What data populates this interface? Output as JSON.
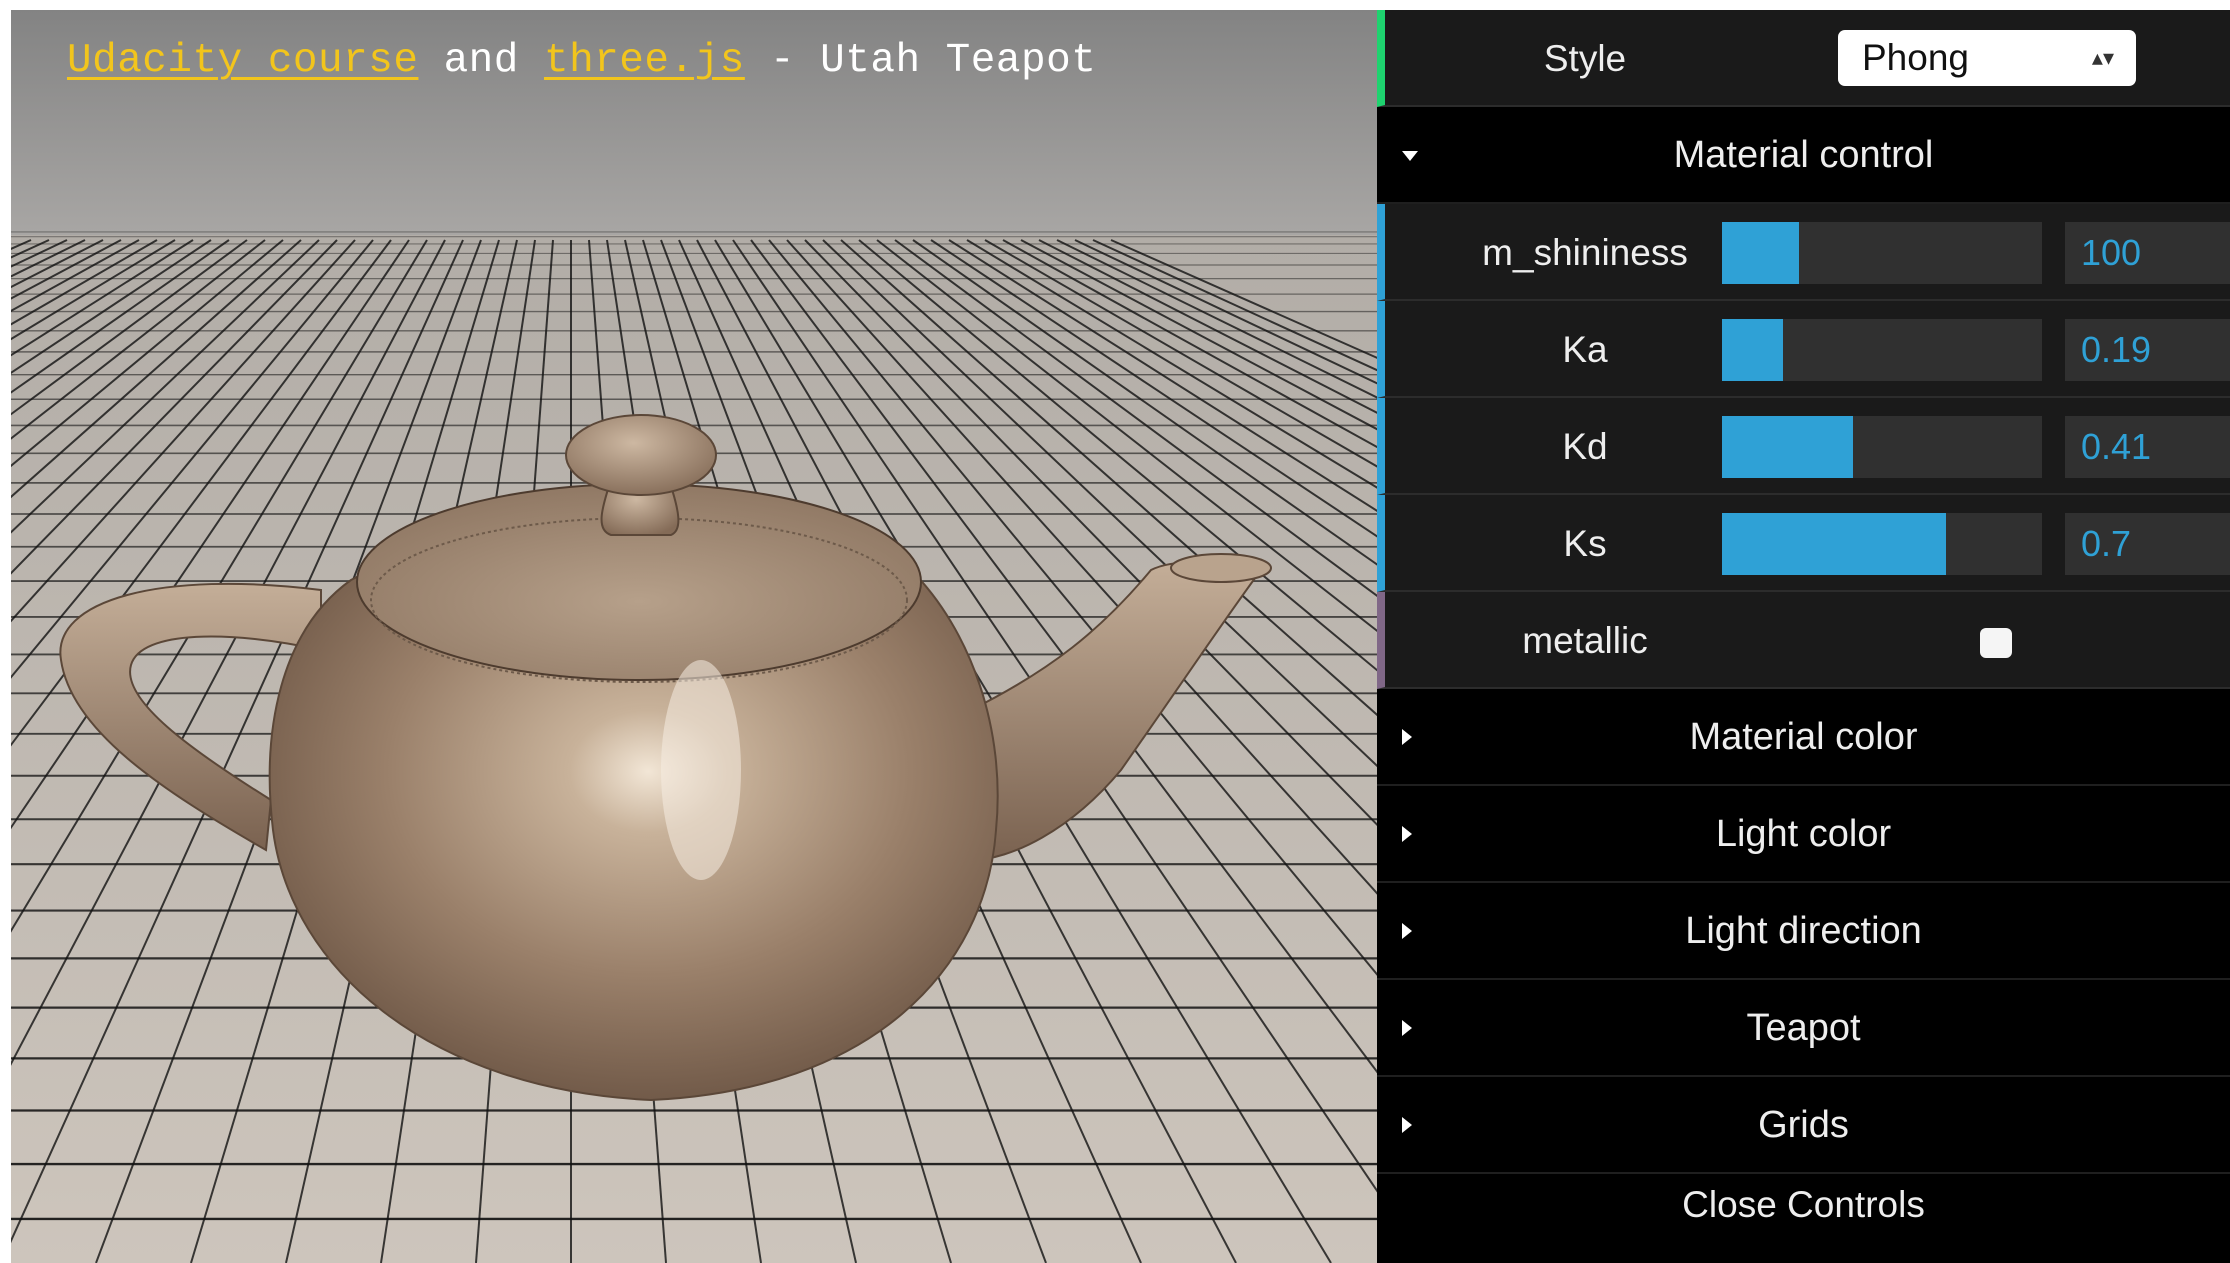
{
  "header": {
    "link1": "Udacity course",
    "connector": " and ",
    "link2": "three.js",
    "suffix": " - Utah Teapot"
  },
  "colors": {
    "link": "#f2c51c",
    "accent_number": "#2fa1d6",
    "accent_boolean": "#806787",
    "accent_option": "#1ed36f",
    "teapot": "#a89078",
    "ground": "#c5bdb4",
    "sky": "#8d8d8d"
  },
  "gui": {
    "style": {
      "label": "Style",
      "selected": "Phong",
      "arrows": "▴▾"
    },
    "material_control": {
      "title": "Material control",
      "open": true,
      "sliders": [
        {
          "label": "m_shininess",
          "value": "100",
          "fraction": 0.24
        },
        {
          "label": "Ka",
          "value": "0.19",
          "fraction": 0.19
        },
        {
          "label": "Kd",
          "value": "0.41",
          "fraction": 0.41
        },
        {
          "label": "Ks",
          "value": "0.7",
          "fraction": 0.7
        }
      ],
      "metallic": {
        "label": "metallic",
        "checked": false
      }
    },
    "folders": [
      {
        "title": "Material color"
      },
      {
        "title": "Light color"
      },
      {
        "title": "Light direction"
      },
      {
        "title": "Teapot"
      },
      {
        "title": "Grids"
      }
    ],
    "close_label": "Close Controls"
  }
}
